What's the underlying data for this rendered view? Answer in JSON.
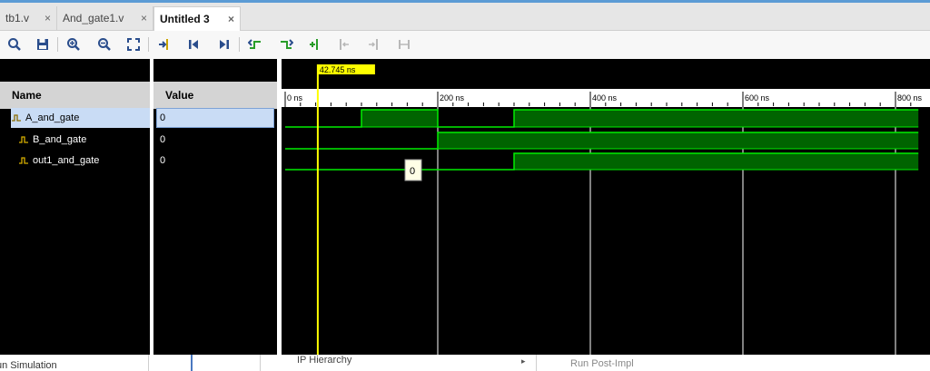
{
  "tabs": [
    {
      "label": "tb1.v",
      "active": false
    },
    {
      "label": "And_gate1.v",
      "active": false
    },
    {
      "label": "Untitled 3",
      "active": true
    }
  ],
  "close_glyph": "×",
  "toolbar": {
    "icons": [
      "search-icon",
      "save-icon",
      "zoom-in-icon",
      "zoom-out-icon",
      "zoom-fit-icon",
      "go-to-cursor-icon",
      "go-to-time-zero-icon",
      "go-to-last-time-icon",
      "previous-transition-icon",
      "next-transition-icon",
      "add-marker-icon",
      "previous-marker-icon",
      "next-marker-icon",
      "swap-cursors-icon"
    ]
  },
  "headers": {
    "name": "Name",
    "value": "Value"
  },
  "signals": [
    {
      "name": "A_and_gate",
      "value": "0",
      "selected": true
    },
    {
      "name": "B_and_gate",
      "value": "0",
      "selected": false
    },
    {
      "name": "out1_and_gate",
      "value": "0",
      "selected": false
    }
  ],
  "cursor": {
    "time_ns": 42.745,
    "label": "42.745  ns",
    "tooltip_value": "0"
  },
  "timeline": {
    "range_ns": [
      0,
      830
    ],
    "major_ticks": [
      {
        "t": 0,
        "label": "0  ns"
      },
      {
        "t": 200,
        "label": "200  ns"
      },
      {
        "t": 400,
        "label": "400  ns"
      },
      {
        "t": 600,
        "label": "600  ns"
      },
      {
        "t": 800,
        "label": "800  ns"
      }
    ]
  },
  "waves": [
    {
      "name": "A_and_gate",
      "segments": [
        [
          0,
          100,
          0
        ],
        [
          100,
          200,
          1
        ],
        [
          200,
          300,
          0
        ],
        [
          300,
          830,
          1
        ]
      ]
    },
    {
      "name": "B_and_gate",
      "segments": [
        [
          0,
          200,
          0
        ],
        [
          200,
          830,
          1
        ]
      ]
    },
    {
      "name": "out1_and_gate",
      "segments": [
        [
          0,
          300,
          0
        ],
        [
          300,
          830,
          1
        ]
      ]
    }
  ],
  "colors": {
    "wave": "#00ee00",
    "wave_fill": "#006400",
    "cursor": "#ffff00",
    "grid": "#ffffff"
  },
  "bottom": {
    "left": "un Simulation",
    "middle": "IP Hierarchy",
    "right": "Run Post-Impl"
  }
}
